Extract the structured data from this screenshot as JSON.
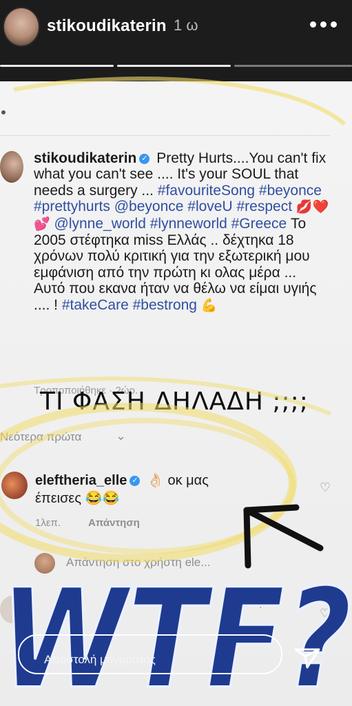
{
  "story": {
    "username": "stikoudikaterin",
    "time": "1 ω",
    "progress_segments": 3
  },
  "post": {
    "username": "stikoudikaterin",
    "line1": "Pretty Hurts....You can't fix what you can't see .... It's your SOUL that needs a  surgery ...",
    "hashtags1": "#favouriteSong #beyonce #prettyhurts",
    "mentions1": "@beyonce #loveU #respect",
    "emoji1": "💋❤️💕",
    "mentions2": "@lynne_world  #lynneworld #Greece",
    "greek_text": "Το 2005 στέφτηκα miss Ελλάς .. δέχτηκα 18 χρόνων  πολύ κριτική για την εξωτερική μου εμφάνιση από την πρώτη  κι ολας μέρα ... Αυτό  που εκανα ήταν να θέλω να είμαι υγιής .... !",
    "hashtags2": "#takeCare #bestrong",
    "emoji2": "💪",
    "meta": "Τροποποιήθηκε · 2ώρ."
  },
  "annotation": {
    "text": "ΤΙ ΦΑΣΗ ΔΗΛΑΔΗ ;;;;"
  },
  "comments": {
    "sort_label": "Νεότερα πρώτα",
    "items": [
      {
        "username": "eleftheria_elle",
        "emoji": "👌🏻",
        "text_a": "οκ μας",
        "text_b": "έπεισες",
        "emoji_b": "😂😂",
        "time": "1λεπ.",
        "reply": "Απάντηση"
      }
    ],
    "reply_to_user": "Απάντηση στο χρήστη ele...",
    "blurred_tail": "ός"
  },
  "overlay": {
    "wtf_text": "WTF?"
  },
  "composer": {
    "placeholder": "Αποστολή μηνύματος"
  },
  "colors": {
    "tag": "#2f4fa0",
    "verify": "#3897f0",
    "highlight": "#f2dc6a",
    "wtf_blue": "#1f3b8f"
  }
}
